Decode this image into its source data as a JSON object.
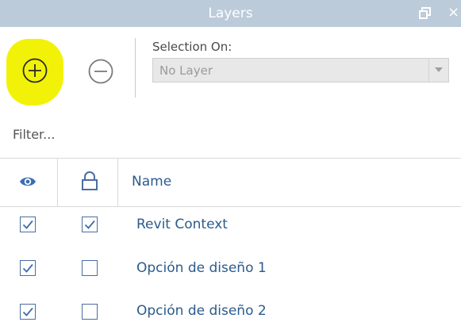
{
  "window": {
    "title": "Layers",
    "close_glyph": "×"
  },
  "toolbar": {
    "add_icon": "add-circle-icon",
    "remove_icon": "remove-circle-icon",
    "selection_label": "Selection On:",
    "selection_value": "No Layer",
    "highlight_color": "#f2f208"
  },
  "filter": {
    "placeholder": "Filter..."
  },
  "table": {
    "columns": {
      "visibility_icon": "eye-icon",
      "lock_icon": "lock-icon",
      "name": "Name"
    },
    "rows": [
      {
        "visible": true,
        "locked": true,
        "name": "Revit Context"
      },
      {
        "visible": true,
        "locked": false,
        "name": "Opción de diseño 1"
      },
      {
        "visible": true,
        "locked": false,
        "name": "Opción de diseño 2"
      }
    ]
  },
  "colors": {
    "titlebar": "#bccbd9",
    "link_text": "#2b5b8c",
    "checkbox_border": "#4a6ea0"
  }
}
